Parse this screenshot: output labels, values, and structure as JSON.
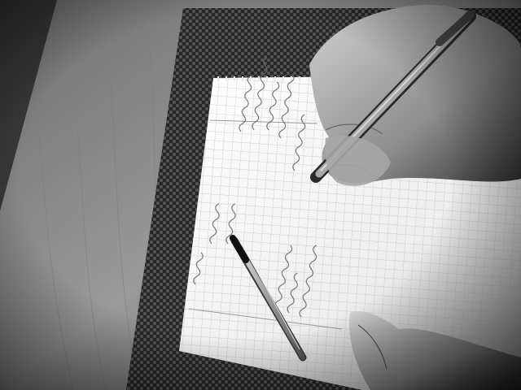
{
  "scene": {
    "kind": "grayscale-photograph",
    "subject": "hand-writing-in-graph-paper-notebook",
    "objects": [
      "wooden-table",
      "woven-placemat",
      "spiral-notebook",
      "mechanical-pencil",
      "pen",
      "right-hand",
      "left-hand"
    ]
  },
  "palette": {
    "table": "#8e8e8e",
    "table_shadow": "#3a3a3a",
    "mat": "#2b2b2b",
    "mat_weave": "#4a4a4a",
    "paper": "#f4f4f4",
    "paper_shadow": "#c9c9c9",
    "grid": "#b8b8b8",
    "ink": "#5a5a5a",
    "skin": "#bdbdbd",
    "skin_shadow": "#6e6e6e"
  }
}
